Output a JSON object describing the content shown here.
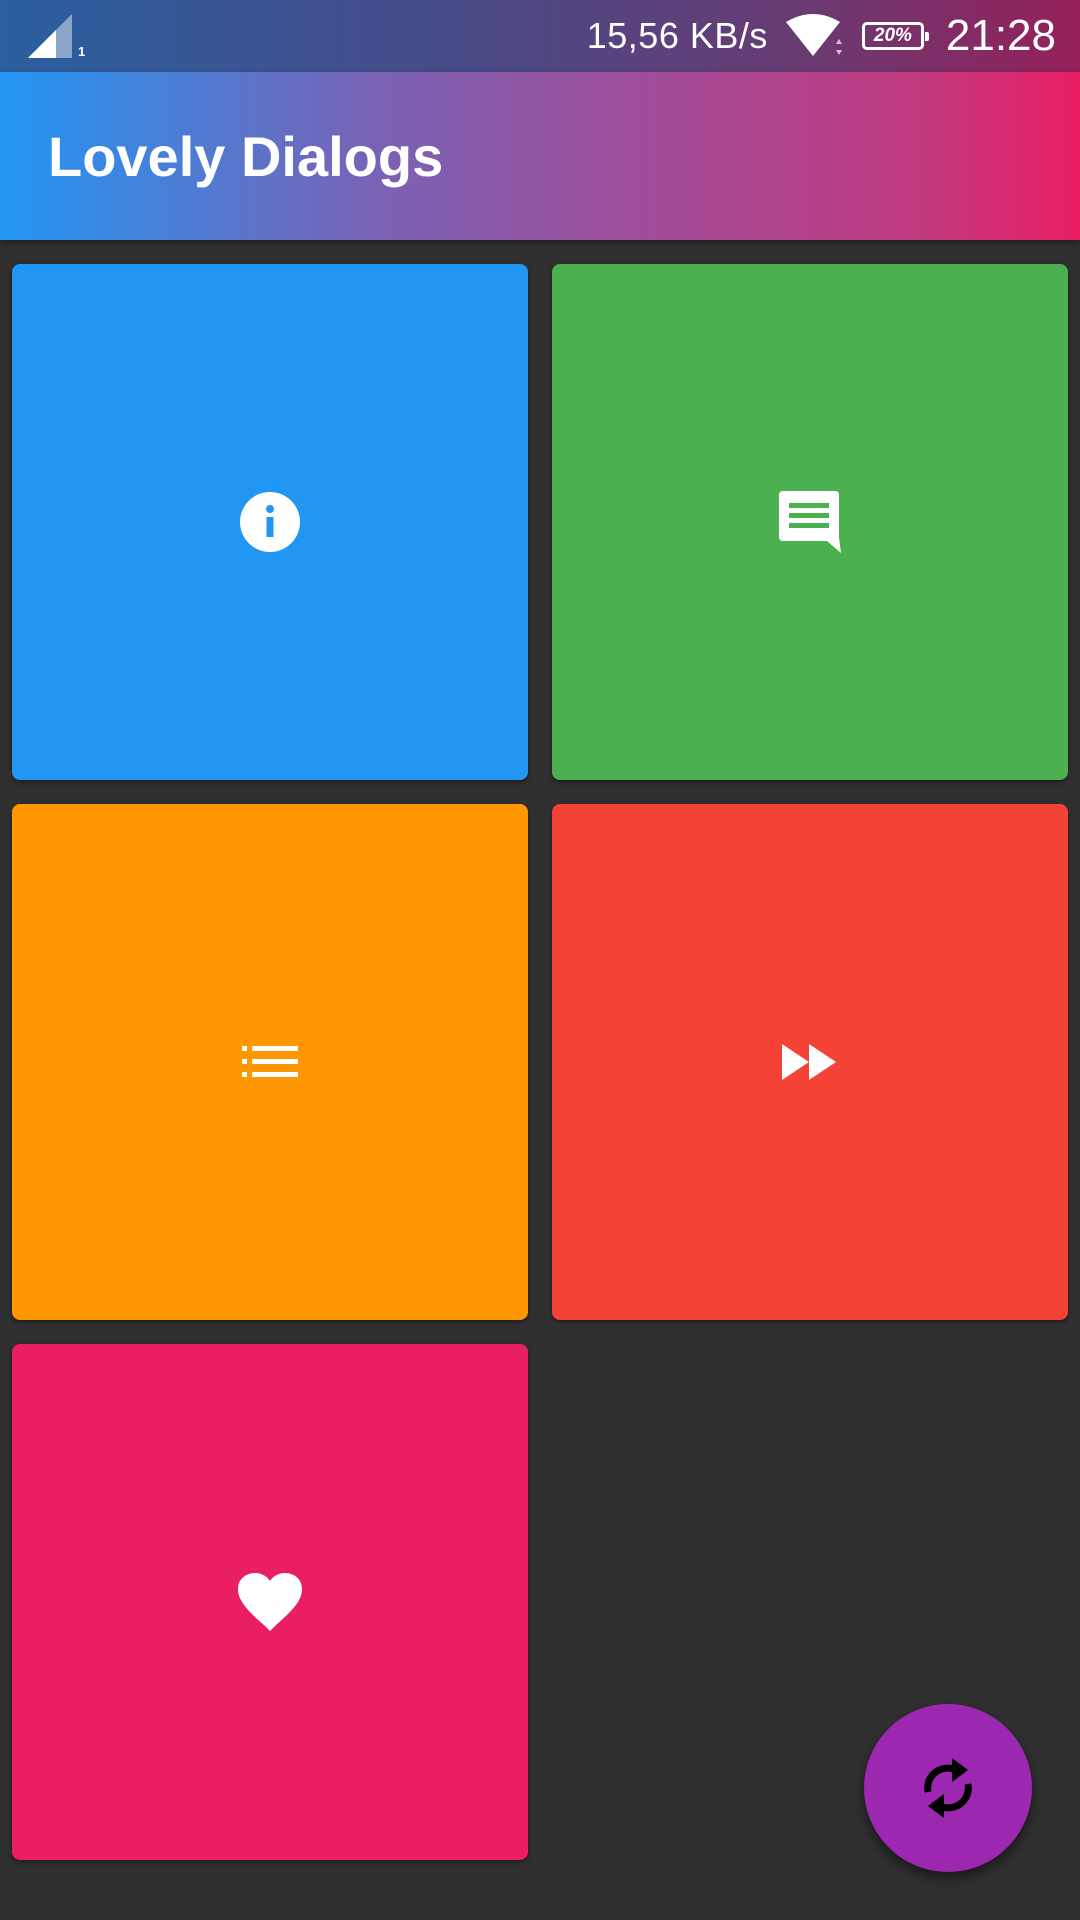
{
  "status_bar": {
    "sim_indicator": "1",
    "net_speed": "15,56  KB/s",
    "battery": "20%",
    "time": "21:28"
  },
  "app_bar": {
    "title": "Lovely Dialogs",
    "gradient_start": "#2196f3",
    "gradient_end": "#e91e63"
  },
  "tiles": [
    {
      "icon": "info-icon",
      "color": "#2196f3"
    },
    {
      "icon": "message-icon",
      "color": "#4caf50"
    },
    {
      "icon": "list-icon",
      "color": "#ff9800"
    },
    {
      "icon": "fast-forward-icon",
      "color": "#f44336"
    },
    {
      "icon": "heart-icon",
      "color": "#e91e63"
    }
  ],
  "fab": {
    "icon": "refresh-icon",
    "color": "#9c27b0"
  }
}
